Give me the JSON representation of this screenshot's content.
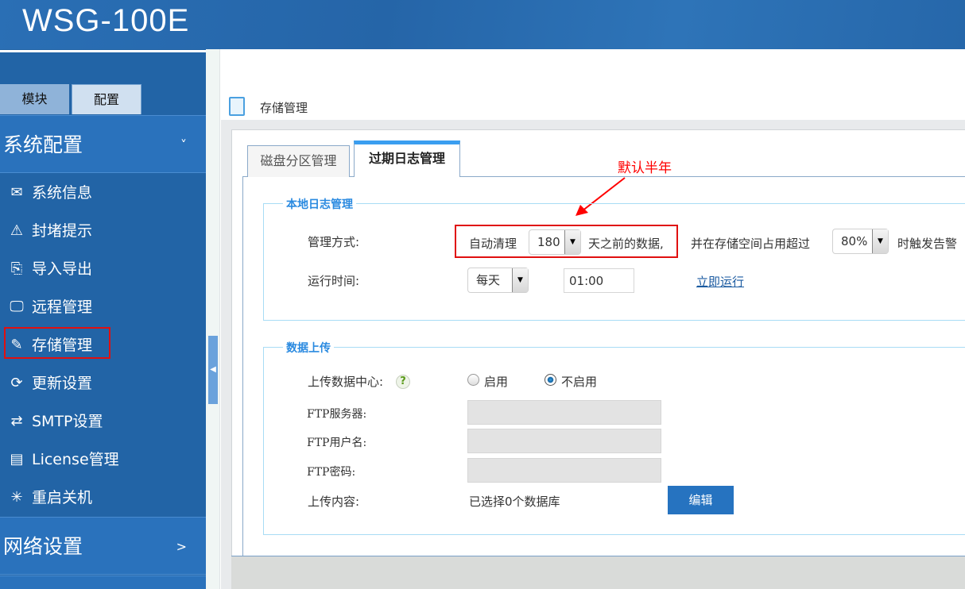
{
  "header": {
    "logo": "WSG-100E"
  },
  "sidebar": {
    "tabs": [
      "模块",
      "配置"
    ],
    "section1": {
      "label": "系统配置",
      "chevron": "˅"
    },
    "items": [
      {
        "label": "系统信息",
        "icon": "envelope-icon"
      },
      {
        "label": "封堵提示",
        "icon": "warning-icon"
      },
      {
        "label": "导入导出",
        "icon": "import-export-icon"
      },
      {
        "label": "远程管理",
        "icon": "remote-monitor-icon"
      },
      {
        "label": "存储管理",
        "icon": "storage-edit-icon",
        "selected": true
      },
      {
        "label": "更新设置",
        "icon": "refresh-icon"
      },
      {
        "label": "SMTP设置",
        "icon": "swap-arrows-icon"
      },
      {
        "label": "License管理",
        "icon": "license-icon"
      },
      {
        "label": "重启关机",
        "icon": "spinner-icon"
      }
    ],
    "section2": {
      "label": "网络设置",
      "chevron": ">"
    }
  },
  "page": {
    "title": "存储管理"
  },
  "tabs": [
    {
      "label": "磁盘分区管理",
      "active": false
    },
    {
      "label": "过期日志管理",
      "active": true
    }
  ],
  "annotation": {
    "text": "默认半年",
    "color": "#ff0000"
  },
  "local": {
    "legend": "本地日志管理",
    "mode_label": "管理方式:",
    "auto_clean": "自动清理",
    "days": "180",
    "days_suffix": "天之前的数据,",
    "and_text": "并在存储空间占用超过",
    "percent": "80%",
    "trigger_text": "时触发告警",
    "time_label": "运行时间:",
    "freq": "每天",
    "time": "01:00",
    "run_now": "立即运行"
  },
  "upload": {
    "legend": "数据上传",
    "center_label": "上传数据中心:",
    "enable": "启用",
    "disable": "不启用",
    "selected": "不启用",
    "ftp_server_label": "FTP服务器:",
    "ftp_user_label": "FTP用户名:",
    "ftp_pass_label": "FTP密码:",
    "content_label": "上传内容:",
    "content_value": "已选择0个数据库",
    "edit": "编辑"
  },
  "colors": {
    "brand": "#2264a6",
    "accent": "#2a8ae0",
    "button": "#2673c0"
  }
}
